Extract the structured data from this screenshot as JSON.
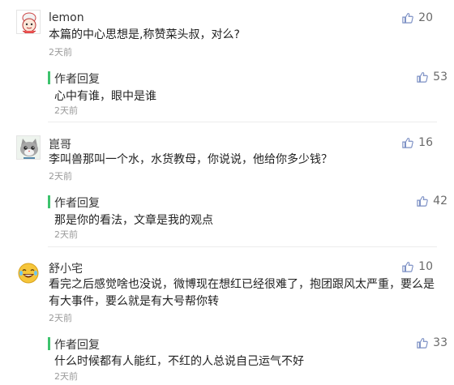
{
  "like_color": "#7b8fc4",
  "accent_green": "#3dc36d",
  "comments": [
    {
      "nickname": "lemon",
      "text": "本篇的中心思想是,称赞菜头叔，对么?",
      "time": "2天前",
      "likes": "20",
      "reply": {
        "label": "作者回复",
        "text": "心中有谁，眼中是谁",
        "time": "2天前",
        "likes": "53"
      }
    },
    {
      "nickname": "崑哥",
      "text": "李叫兽那叫一个水，水货教母，你说说，他给你多少钱？",
      "time": "2天前",
      "likes": "16",
      "reply": {
        "label": "作者回复",
        "text": "那是你的看法，文章是我的观点",
        "time": "2天前",
        "likes": "42"
      }
    },
    {
      "nickname": "舒小宅",
      "text_line1": "看完之后感觉啥也没说，微博现在想红已经很难了，抱团跟风太严重，要么是",
      "text_line2": "有大事件，要么就是有大号帮你转",
      "time": "2天前",
      "likes": "10",
      "reply": {
        "label": "作者回复",
        "text": "什么时候都有人能红，不红的人总说自己运气不好",
        "time": "2天前",
        "likes": "33"
      }
    }
  ]
}
